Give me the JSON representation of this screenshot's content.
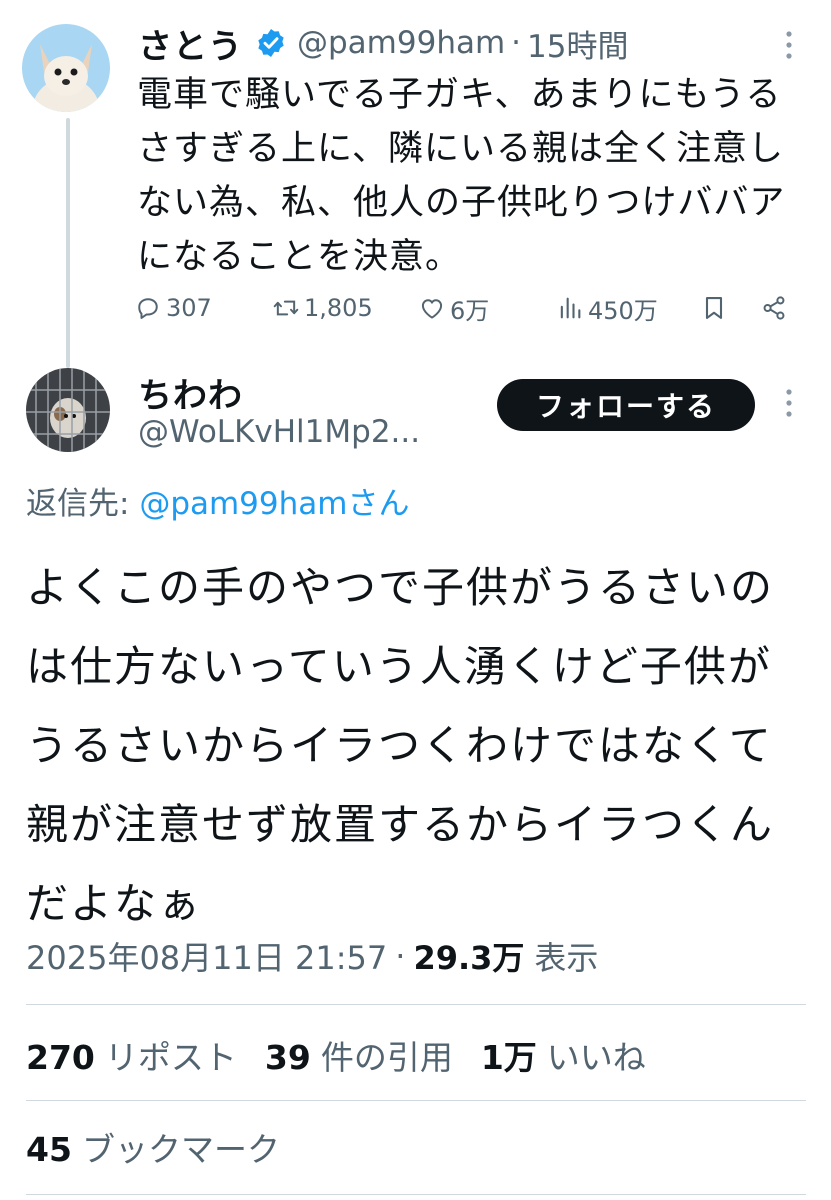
{
  "parent_tweet": {
    "display_name": "さとう",
    "handle": "@pam99ham",
    "separator": "·",
    "time_ago": "15時間",
    "text": "電車で騒いでる子ガキ、あまりにもうるさすぎる上に、隣にいる親は全く注意しない為、私、他人の子供叱りつけババアになることを決意。",
    "replies": "307",
    "reposts": "1,805",
    "likes": "6万",
    "views": "450万"
  },
  "reply_tweet": {
    "display_name": "ちわわ",
    "handle": "@WoLKvHl1Mp2...",
    "follow_label": "フォローする",
    "reply_to_prefix": "返信先: ",
    "reply_to_handle": "@pam99hamさん",
    "text": "よくこの手のやつで子供がうるさいのは仕方ないっていう人湧くけど子供がうるさいからイラつくわけではなくて親が注意せず放置するからイラつくんだよなぁ",
    "datetime": "2025年08月11日 21:57",
    "separator": "·",
    "view_count": "29.3万",
    "view_label": "表示",
    "stats": {
      "reposts_count": "270",
      "reposts_label": "リポスト",
      "quotes_count": "39",
      "quotes_label": "件の引用",
      "likes_count": "1万",
      "likes_label": "いいね",
      "bookmarks_count": "45",
      "bookmarks_label": "ブックマーク"
    }
  },
  "colors": {
    "text_primary": "#0f1419",
    "text_secondary": "#536471",
    "link": "#1d9bf0",
    "verified": "#1d9bf0",
    "divider": "#cfd9de"
  },
  "icons": [
    "verified-badge-icon",
    "more-icon",
    "reply-icon",
    "repost-icon",
    "like-icon",
    "views-icon",
    "bookmark-icon",
    "share-icon"
  ]
}
